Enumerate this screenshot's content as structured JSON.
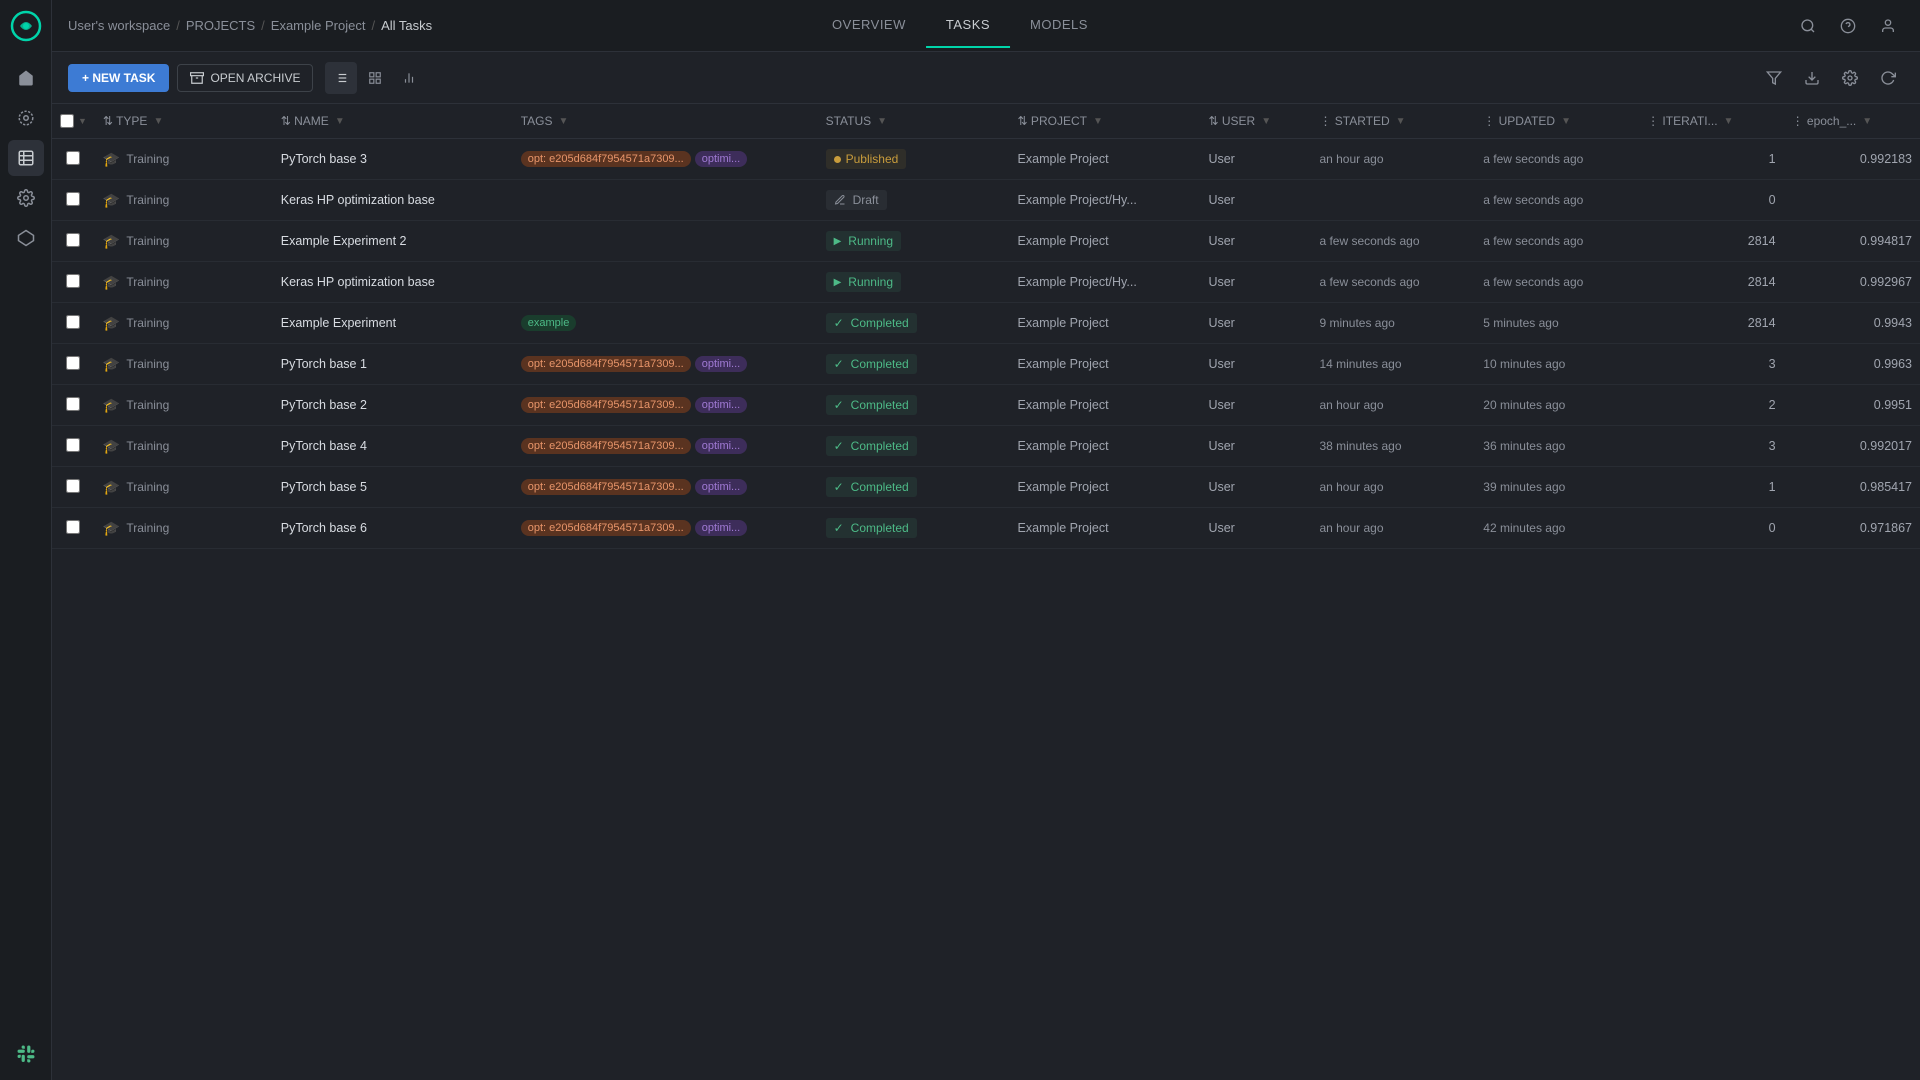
{
  "app": {
    "logo": "C",
    "workspace": "User's workspace",
    "breadcrumb": [
      "PROJECTS",
      "Example Project",
      "All Tasks"
    ]
  },
  "topnav": {
    "tabs": [
      {
        "label": "OVERVIEW",
        "active": false
      },
      {
        "label": "TASKS",
        "active": true
      },
      {
        "label": "MODELS",
        "active": false
      }
    ]
  },
  "toolbar": {
    "new_task_label": "+ NEW TASK",
    "open_archive_label": "OPEN ARCHIVE"
  },
  "columns": [
    {
      "key": "type",
      "label": "TYPE",
      "filterable": true
    },
    {
      "key": "name",
      "label": "NAME",
      "filterable": true
    },
    {
      "key": "tags",
      "label": "TAGS",
      "filterable": true
    },
    {
      "key": "status",
      "label": "STATUS",
      "filterable": true
    },
    {
      "key": "project",
      "label": "PROJECT",
      "filterable": true
    },
    {
      "key": "user",
      "label": "USER",
      "filterable": true
    },
    {
      "key": "started",
      "label": "STARTED",
      "filterable": true
    },
    {
      "key": "updated",
      "label": "UPDATED",
      "filterable": true
    },
    {
      "key": "iterations",
      "label": "ITERATI...",
      "filterable": true
    },
    {
      "key": "epoch",
      "label": "epoch_...",
      "filterable": true
    }
  ],
  "rows": [
    {
      "id": 1,
      "type": "Training",
      "name": "PyTorch base 3",
      "tags": [
        {
          "text": "opt: e205d684f7954571a7309...",
          "style": "orange"
        },
        {
          "text": "optimi...",
          "style": "purple"
        }
      ],
      "status": "Published",
      "status_type": "published",
      "project": "Example Project",
      "user": "User",
      "started": "an hour ago",
      "updated": "a few seconds ago",
      "iterations": "1",
      "epoch": "0.992183"
    },
    {
      "id": 2,
      "type": "Training",
      "name": "Keras HP optimization base",
      "tags": [],
      "status": "Draft",
      "status_type": "draft",
      "project": "Example Project/Hy...",
      "user": "User",
      "started": "",
      "updated": "a few seconds ago",
      "iterations": "0",
      "epoch": ""
    },
    {
      "id": 3,
      "type": "Training",
      "name": "Example Experiment 2",
      "tags": [],
      "status": "Running",
      "status_type": "running",
      "project": "Example Project",
      "user": "User",
      "started": "a few seconds ago",
      "updated": "a few seconds ago",
      "iterations": "2814",
      "epoch": "0.994817"
    },
    {
      "id": 4,
      "type": "Training",
      "name": "Keras HP optimization base",
      "tags": [],
      "status": "Running",
      "status_type": "running",
      "project": "Example Project/Hy...",
      "user": "User",
      "started": "a few seconds ago",
      "updated": "a few seconds ago",
      "iterations": "2814",
      "epoch": "0.992967"
    },
    {
      "id": 5,
      "type": "Training",
      "name": "Example Experiment",
      "tags": [
        {
          "text": "example",
          "style": "green"
        }
      ],
      "status": "Completed",
      "status_type": "completed",
      "project": "Example Project",
      "user": "User",
      "started": "9 minutes ago",
      "updated": "5 minutes ago",
      "iterations": "2814",
      "epoch": "0.9943"
    },
    {
      "id": 6,
      "type": "Training",
      "name": "PyTorch base 1",
      "tags": [
        {
          "text": "opt: e205d684f7954571a7309...",
          "style": "orange"
        },
        {
          "text": "optimi...",
          "style": "purple"
        }
      ],
      "status": "Completed",
      "status_type": "completed",
      "project": "Example Project",
      "user": "User",
      "started": "14 minutes ago",
      "updated": "10 minutes ago",
      "iterations": "3",
      "epoch": "0.9963"
    },
    {
      "id": 7,
      "type": "Training",
      "name": "PyTorch base 2",
      "tags": [
        {
          "text": "opt: e205d684f7954571a7309...",
          "style": "orange"
        },
        {
          "text": "optimi...",
          "style": "purple"
        }
      ],
      "status": "Completed",
      "status_type": "completed",
      "project": "Example Project",
      "user": "User",
      "started": "an hour ago",
      "updated": "20 minutes ago",
      "iterations": "2",
      "epoch": "0.9951"
    },
    {
      "id": 8,
      "type": "Training",
      "name": "PyTorch base 4",
      "tags": [
        {
          "text": "opt: e205d684f7954571a7309...",
          "style": "orange"
        },
        {
          "text": "optimi...",
          "style": "purple"
        }
      ],
      "status": "Completed",
      "status_type": "completed",
      "project": "Example Project",
      "user": "User",
      "started": "38 minutes ago",
      "updated": "36 minutes ago",
      "iterations": "3",
      "epoch": "0.992017"
    },
    {
      "id": 9,
      "type": "Training",
      "name": "PyTorch base 5",
      "tags": [
        {
          "text": "opt: e205d684f7954571a7309...",
          "style": "orange"
        },
        {
          "text": "optimi...",
          "style": "purple"
        }
      ],
      "status": "Completed",
      "status_type": "completed",
      "project": "Example Project",
      "user": "User",
      "started": "an hour ago",
      "updated": "39 minutes ago",
      "iterations": "1",
      "epoch": "0.985417"
    },
    {
      "id": 10,
      "type": "Training",
      "name": "PyTorch base 6",
      "tags": [
        {
          "text": "opt: e205d684f7954571a7309...",
          "style": "orange"
        },
        {
          "text": "optimi...",
          "style": "purple"
        }
      ],
      "status": "Completed",
      "status_type": "completed",
      "project": "Example Project",
      "user": "User",
      "started": "an hour ago",
      "updated": "42 minutes ago",
      "iterations": "0",
      "epoch": "0.971867"
    }
  ],
  "sidebar": {
    "items": [
      {
        "icon": "⊞",
        "name": "dashboard",
        "label": "Dashboard"
      },
      {
        "icon": "◎",
        "name": "experiments",
        "label": "Experiments"
      },
      {
        "icon": "≡",
        "name": "reports",
        "label": "Reports"
      },
      {
        "icon": "⚙",
        "name": "settings",
        "label": "Settings",
        "active": true
      },
      {
        "icon": "⬡",
        "name": "pipelines",
        "label": "Pipelines"
      }
    ]
  }
}
